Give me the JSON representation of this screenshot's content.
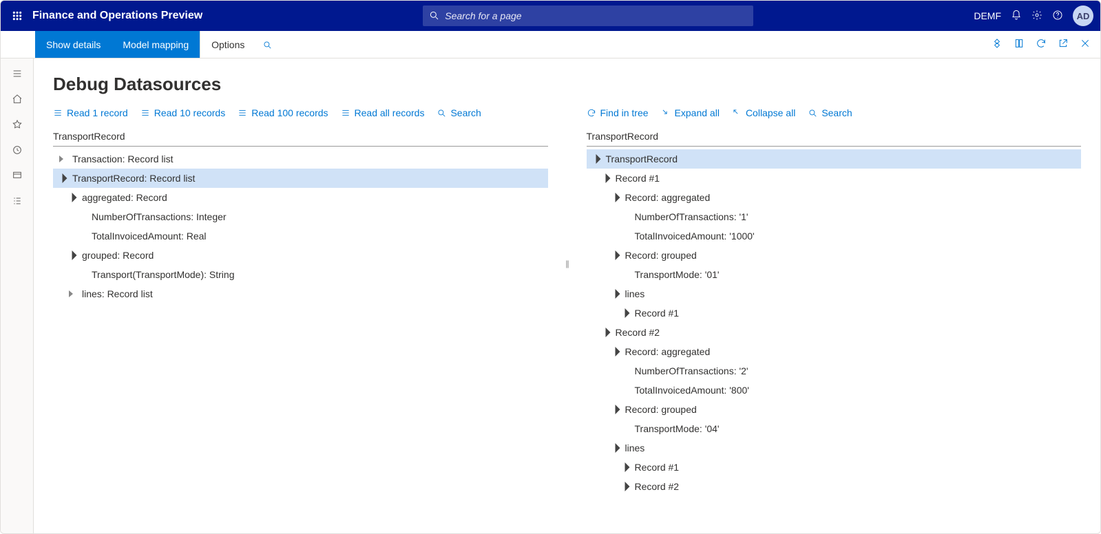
{
  "topbar": {
    "app_title": "Finance and Operations Preview",
    "search_placeholder": "Search for a page",
    "company": "DEMF",
    "avatar_initials": "AD"
  },
  "actionbar": {
    "show_details": "Show details",
    "model_mapping": "Model mapping",
    "options": "Options"
  },
  "page": {
    "title": "Debug Datasources"
  },
  "left_toolbar": {
    "read1": "Read 1 record",
    "read10": "Read 10 records",
    "read100": "Read 100 records",
    "readall": "Read all records",
    "search": "Search"
  },
  "right_toolbar": {
    "find_in_tree": "Find in tree",
    "expand_all": "Expand all",
    "collapse_all": "Collapse all",
    "search": "Search"
  },
  "left_pane": {
    "header": "TransportRecord",
    "rows": [
      {
        "indent": 1,
        "toggle": "closed",
        "label": "Transaction: Record list",
        "selected": false
      },
      {
        "indent": 1,
        "toggle": "open",
        "label": "TransportRecord: Record list",
        "selected": true
      },
      {
        "indent": 2,
        "toggle": "open",
        "label": "aggregated: Record",
        "selected": false
      },
      {
        "indent": 3,
        "toggle": "none",
        "label": "NumberOfTransactions: Integer",
        "selected": false
      },
      {
        "indent": 3,
        "toggle": "none",
        "label": "TotalInvoicedAmount: Real",
        "selected": false
      },
      {
        "indent": 2,
        "toggle": "open",
        "label": "grouped: Record",
        "selected": false
      },
      {
        "indent": 3,
        "toggle": "none",
        "label": "Transport(TransportMode): String",
        "selected": false
      },
      {
        "indent": 2,
        "toggle": "closed",
        "label": "lines: Record list",
        "selected": false
      }
    ]
  },
  "right_pane": {
    "header": "TransportRecord",
    "rows": [
      {
        "indent": 1,
        "toggle": "open",
        "label": "TransportRecord",
        "selected": true
      },
      {
        "indent": 2,
        "toggle": "open",
        "label": "Record #1",
        "selected": false
      },
      {
        "indent": 3,
        "toggle": "open",
        "label": "Record: aggregated",
        "selected": false
      },
      {
        "indent": 4,
        "toggle": "none",
        "label": "NumberOfTransactions: '1'",
        "selected": false
      },
      {
        "indent": 4,
        "toggle": "none",
        "label": "TotalInvoicedAmount: '1000'",
        "selected": false
      },
      {
        "indent": 3,
        "toggle": "open",
        "label": "Record: grouped",
        "selected": false
      },
      {
        "indent": 4,
        "toggle": "none",
        "label": "TransportMode: '01'",
        "selected": false
      },
      {
        "indent": 3,
        "toggle": "open",
        "label": "lines",
        "selected": false
      },
      {
        "indent": 4,
        "toggle": "open",
        "label": "Record #1",
        "selected": false
      },
      {
        "indent": 2,
        "toggle": "open",
        "label": "Record #2",
        "selected": false
      },
      {
        "indent": 3,
        "toggle": "open",
        "label": "Record: aggregated",
        "selected": false
      },
      {
        "indent": 4,
        "toggle": "none",
        "label": "NumberOfTransactions: '2'",
        "selected": false
      },
      {
        "indent": 4,
        "toggle": "none",
        "label": "TotalInvoicedAmount: '800'",
        "selected": false
      },
      {
        "indent": 3,
        "toggle": "open",
        "label": "Record: grouped",
        "selected": false
      },
      {
        "indent": 4,
        "toggle": "none",
        "label": "TransportMode: '04'",
        "selected": false
      },
      {
        "indent": 3,
        "toggle": "open",
        "label": "lines",
        "selected": false
      },
      {
        "indent": 4,
        "toggle": "open",
        "label": "Record #1",
        "selected": false
      },
      {
        "indent": 4,
        "toggle": "open",
        "label": "Record #2",
        "selected": false
      }
    ]
  }
}
